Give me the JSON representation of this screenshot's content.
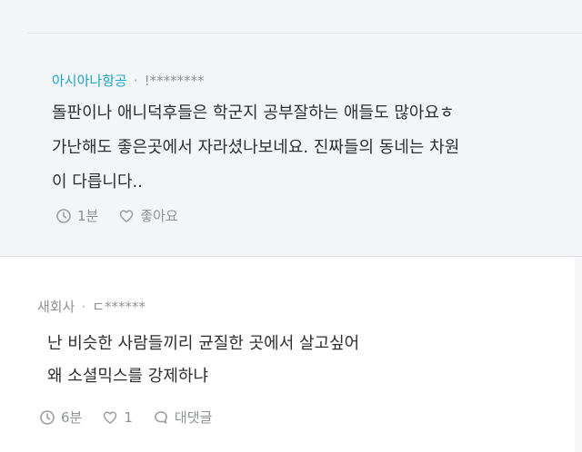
{
  "reply": {
    "author": "아시아나항공",
    "separator": "·",
    "user_masked": "!********",
    "lines": [
      "돌판이나 애니덕후들은 학군지 공부잘하는 애들도 많아요ㅎ",
      "가난해도 좋은곳에서 자라셨나보네요. 진짜들의 동네는 차원",
      "이 다릅니다.."
    ],
    "time": "1분",
    "like_label": "좋아요"
  },
  "comment": {
    "author": "새회사",
    "separator": "·",
    "user_masked": "ㄷ******",
    "lines": [
      "난 비슷한 사람들끼리 균질한 곳에서 살고싶어",
      "왜 소셜믹스를 강제하냐"
    ],
    "time": "6분",
    "like_count": "1",
    "reply_label": "대댓글"
  },
  "icons": {
    "time": "clock-icon",
    "like": "heart-icon",
    "reply": "speech-bubble-icon"
  },
  "colors": {
    "page_background": "#f4f5f6",
    "comment_background": "#ffffff",
    "reply_author": "#1fa6c7",
    "body_text": "#2e2f33",
    "meta_text": "#8e9196"
  }
}
